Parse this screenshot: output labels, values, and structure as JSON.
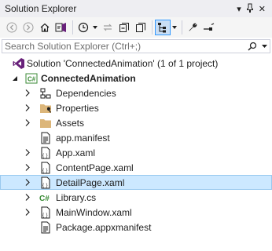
{
  "panel": {
    "title": "Solution Explorer",
    "pin_glyph": "⊣",
    "dropdown_glyph": "▾",
    "close_glyph": "✕"
  },
  "search": {
    "placeholder": "Search Solution Explorer (Ctrl+;)"
  },
  "toolbar": {
    "buttons": [
      "back",
      "forward",
      "home",
      "switch-views",
      "pending-changes-filter",
      "sync-with-active-document",
      "collapse-all",
      "show-all-files",
      "preview-selected-items",
      "properties",
      "settings-wrench"
    ]
  },
  "tree": {
    "solution": "Solution 'ConnectedAnimation' (1 of 1 project)",
    "project": "ConnectedAnimation",
    "items": [
      {
        "label": "Dependencies"
      },
      {
        "label": "Properties"
      },
      {
        "label": "Assets"
      },
      {
        "label": "app.manifest"
      },
      {
        "label": "App.xaml"
      },
      {
        "label": "ContentPage.xaml"
      },
      {
        "label": "DetailPage.xaml",
        "selected": true
      },
      {
        "label": "Library.cs"
      },
      {
        "label": "MainWindow.xaml"
      },
      {
        "label": "Package.appxmanifest"
      }
    ]
  },
  "colors": {
    "selection_bg": "#cce8ff",
    "selection_border": "#99c9ef",
    "csharp_green": "#388a34",
    "folder_yellow": "#dcb67a",
    "vs_purple": "#68217a"
  }
}
